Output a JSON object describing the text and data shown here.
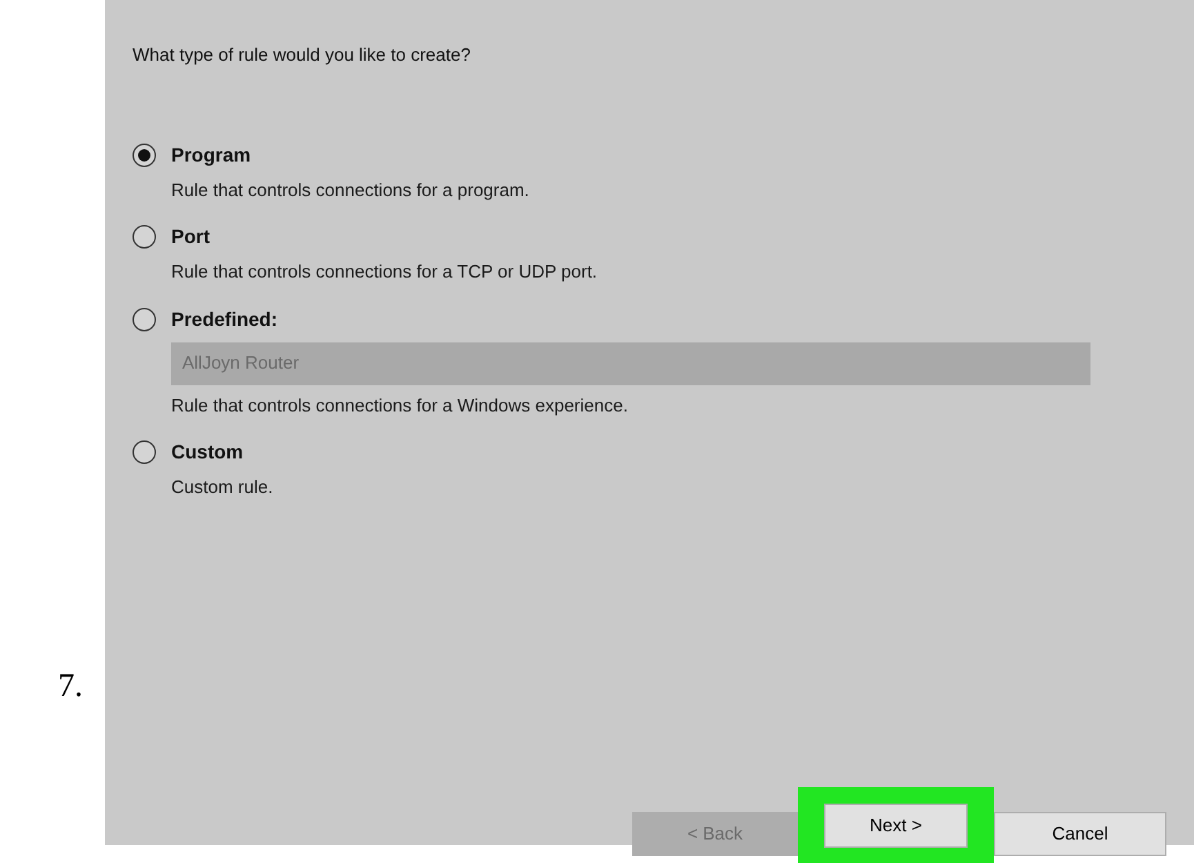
{
  "step_number": "7.",
  "question": "What type of rule would you like to create?",
  "options": [
    {
      "label": "Program",
      "description": "Rule that controls connections for a program.",
      "selected": true
    },
    {
      "label": "Port",
      "description": "Rule that controls connections for a TCP or UDP port.",
      "selected": false
    },
    {
      "label": "Predefined:",
      "description": "Rule that controls connections for a Windows experience.",
      "selected": false,
      "dropdown": {
        "value": "AllJoyn Router",
        "disabled": true
      }
    },
    {
      "label": "Custom",
      "description": "Custom rule.",
      "selected": false
    }
  ],
  "buttons": [
    {
      "label": "< Back",
      "disabled": true,
      "highlighted": false
    },
    {
      "label": "Next >",
      "disabled": false,
      "highlighted": true
    },
    {
      "label": "Cancel",
      "disabled": false,
      "highlighted": false
    }
  ]
}
